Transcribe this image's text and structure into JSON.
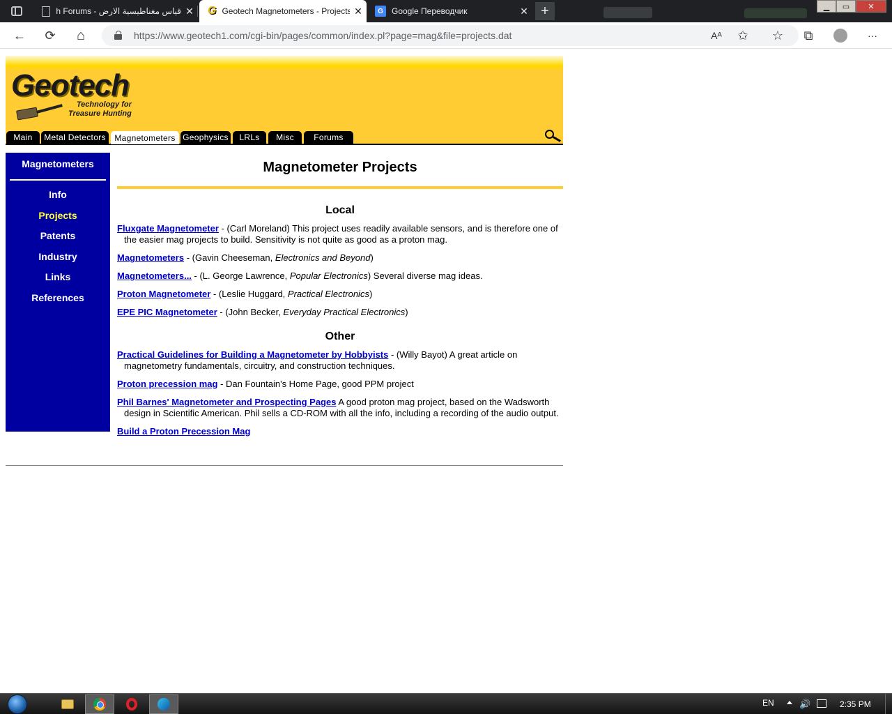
{
  "browser": {
    "tabs": [
      {
        "title": "قياس مغناطيسية الارض - Geotech Forums",
        "active": false
      },
      {
        "title": "Geotech Magnetometers - Projects",
        "active": true
      },
      {
        "title": "Google Переводчик",
        "active": false
      }
    ],
    "url": "https://www.geotech1.com/cgi-bin/pages/common/index.pl?page=mag&file=projects.dat",
    "icons": {
      "back": "←",
      "reload": "⟳",
      "home": "⌂",
      "read_aloud": "Aᴬ",
      "add_favorite": "✩",
      "favorites": "☆",
      "collections": "⧉",
      "menu": "···",
      "new_tab": "+",
      "tab_close": "✕"
    },
    "window": {
      "minimize": "▁",
      "maximize": "▭",
      "close": "✕"
    }
  },
  "site": {
    "logo": "Geotech",
    "tagline_line1": "Technology for",
    "tagline_line2": "Treasure Hunting",
    "nav": [
      "Main",
      "Metal Detectors",
      "Magnetometers",
      "Geophysics",
      "LRLs",
      "Misc",
      "Forums"
    ],
    "nav_active": "Magnetometers"
  },
  "sidebar": {
    "title": "Magnetometers",
    "links": [
      {
        "label": "Info",
        "current": false
      },
      {
        "label": "Projects",
        "current": true
      },
      {
        "label": "Patents",
        "current": false
      },
      {
        "label": "Industry",
        "current": false
      },
      {
        "label": "Links",
        "current": false
      },
      {
        "label": "References",
        "current": false
      }
    ]
  },
  "content": {
    "title": "Magnetometer Projects",
    "local_heading": "Local",
    "local": [
      {
        "link": "Fluxgate Magnetometer",
        "pre": " - (Carl Moreland) This project uses readily available sensors, and is therefore one of the easier mag projects to build. Sensitivity is not quite as good as a proton mag.",
        "ital": "",
        "post": ""
      },
      {
        "link": "Magnetometers",
        "pre": " - (Gavin Cheeseman, ",
        "ital": "Electronics and Beyond",
        "post": ")"
      },
      {
        "link": "Magnetometers...",
        "pre": " - (L. George Lawrence, ",
        "ital": "Popular Electronics",
        "post": ") Several diverse mag ideas."
      },
      {
        "link": "Proton Magnetometer",
        "pre": " - (Leslie Huggard, ",
        "ital": "Practical Electronics",
        "post": ")"
      },
      {
        "link": "EPE PIC Magnetometer",
        "pre": " - (John Becker, ",
        "ital": "Everyday Practical Electronics",
        "post": ")"
      }
    ],
    "other_heading": "Other",
    "other": [
      {
        "link": "Practical Guidelines for Building a Magnetometer by Hobbyists",
        "pre": " - (Willy Bayot) A great article on magnetometry fundamentals, circuitry, and construction techniques.",
        "ital": "",
        "post": ""
      },
      {
        "link": "Proton precession mag",
        "pre": " - Dan Fountain's Home Page, good PPM project",
        "ital": "",
        "post": ""
      },
      {
        "link": "Phil Barnes' Magnetometer and Prospecting Pages",
        "pre": " A good proton mag project, based on the Wadsworth design in Scientific American. Phil sells a CD-ROM with all the info, including a recording of the audio output.",
        "ital": "",
        "post": ""
      },
      {
        "link": "Build a Proton Precession Mag",
        "pre": "",
        "ital": "",
        "post": ""
      }
    ]
  },
  "taskbar": {
    "language": "EN",
    "clock": "2:35 PM",
    "volume_icon": "🔊"
  }
}
